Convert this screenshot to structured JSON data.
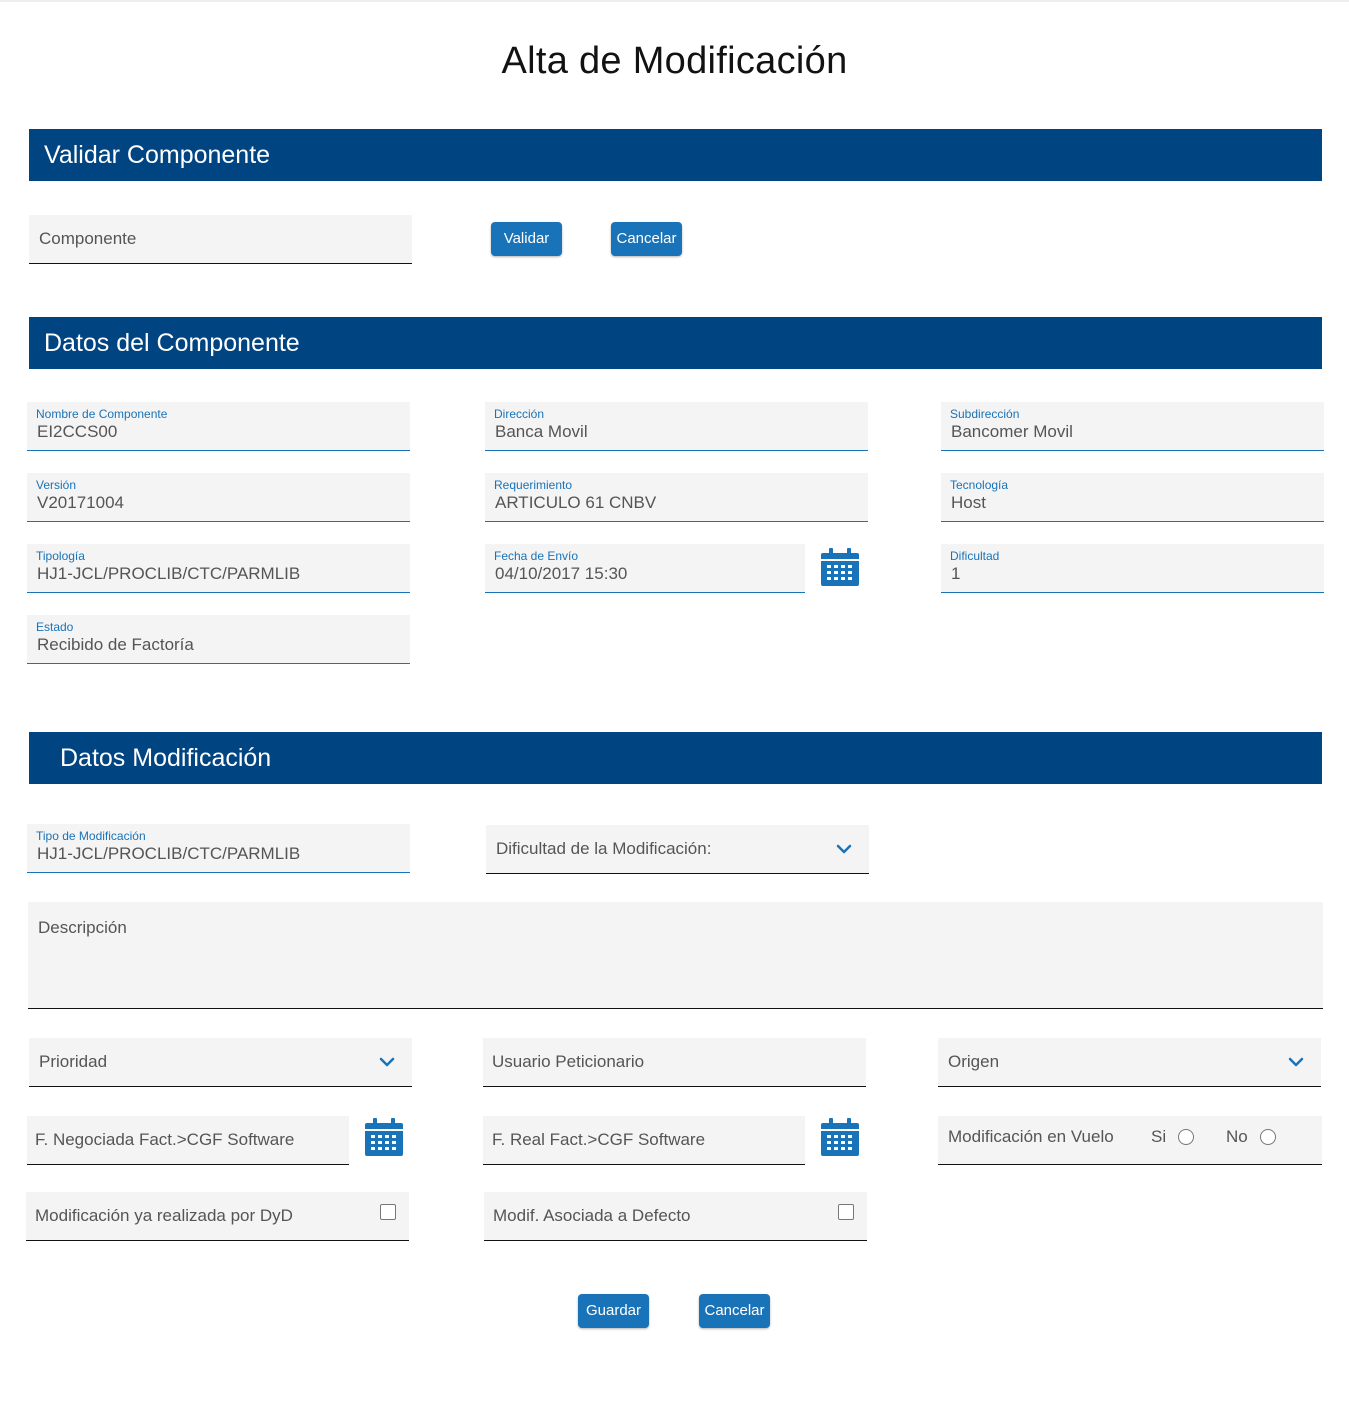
{
  "title": "Alta de Modificación",
  "validar": {
    "header": "Validar Componente",
    "componente_placeholder": "Componente",
    "validar_label": "Validar",
    "cancelar_label": "Cancelar"
  },
  "datos_componente": {
    "header": "Datos del Componente",
    "fields": [
      {
        "label": "Nombre de Componente",
        "value": "EI2CCS00"
      },
      {
        "label": "Dirección",
        "value": "Banca Movil"
      },
      {
        "label": "Subdirección",
        "value": "Bancomer Movil"
      },
      {
        "label": "Versión",
        "value": "V20171004"
      },
      {
        "label": "Requerimiento",
        "value": "ARTICULO 61 CNBV"
      },
      {
        "label": "Tecnología",
        "value": "Host"
      },
      {
        "label": "Tipología",
        "value": "HJ1-JCL/PROCLIB/CTC/PARMLIB"
      },
      {
        "label": "Fecha de Envío",
        "value": "04/10/2017 15:30"
      },
      {
        "label": "Dificultad",
        "value": "1"
      },
      {
        "label": "Estado",
        "value": "Recibido de Factoría"
      }
    ]
  },
  "datos_modificacion": {
    "header": "Datos Modificación",
    "tipo_label": "Tipo de Modificación",
    "tipo_value": "HJ1-JCL/PROCLIB/CTC/PARMLIB",
    "dificultad_placeholder": "Dificultad de la Modificación:",
    "descripcion_placeholder": "Descripción",
    "prioridad_placeholder": "Prioridad",
    "usuario_placeholder": "Usuario Peticionario",
    "origen_placeholder": "Origen",
    "f_negociada_placeholder": "F. Negociada Fact.>CGF Software",
    "f_real_placeholder": "F. Real Fact.>CGF Software",
    "vuelo_label": "Modificación en Vuelo",
    "si_label": "Si",
    "no_label": "No",
    "dyd_label": "Modificación ya realizada por DyD",
    "defecto_label": "Modif. Asociada a Defecto",
    "guardar_label": "Guardar",
    "cancelar_label": "Cancelar"
  },
  "colors": {
    "primary": "#004481",
    "accent": "#1973b8",
    "field_bg": "#f4f4f4"
  },
  "icons": [
    "calendar-icon",
    "chevron-down-icon",
    "checkbox",
    "radio"
  ]
}
